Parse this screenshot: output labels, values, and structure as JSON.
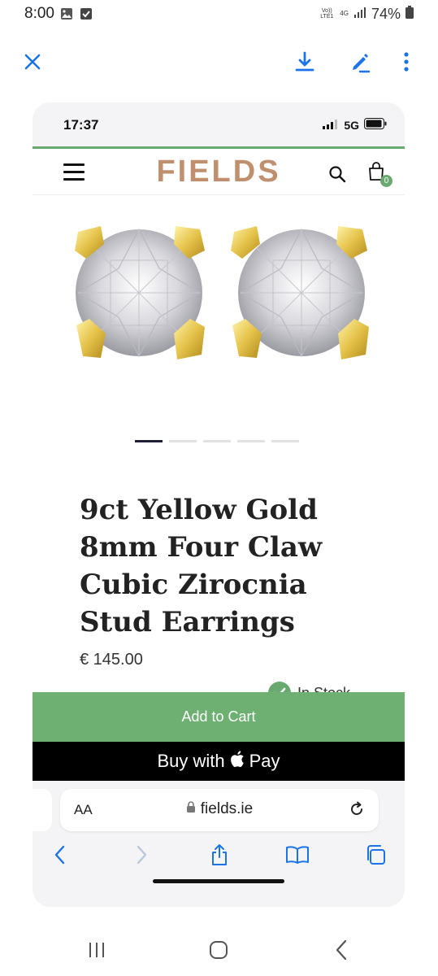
{
  "android_status": {
    "time": "8:00",
    "volte": "Vo)) LTE1",
    "network": "4G",
    "battery": "74%",
    "icons": [
      "gallery-icon",
      "checkbox-icon",
      "signal-icon",
      "battery-icon"
    ]
  },
  "viewer_toolbar": {
    "icons": [
      "close-icon",
      "download-icon",
      "edit-icon",
      "more-vert-icon"
    ],
    "accent_color": "#1a73e8"
  },
  "ios_status": {
    "time": "17:37",
    "network": "5G"
  },
  "site": {
    "logo": "FIELDS",
    "brand_color": "#c0906e",
    "accent_color": "#6aa96f",
    "cart_count": "0",
    "carousel": {
      "total": 5,
      "active": 1
    }
  },
  "product": {
    "title": "9ct Yellow Gold 8mm Four Claw Cubic Zirocnia Stud Earrings",
    "price": "€ 145.00",
    "stock": "In Stock"
  },
  "actions": {
    "add_to_cart": "Add to Cart",
    "buy_with": "Buy with",
    "pay": "Pay"
  },
  "safari": {
    "aa": "AA",
    "url": "fields.ie",
    "icons": [
      "back-icon",
      "forward-icon",
      "share-icon",
      "bookmarks-icon",
      "tabs-icon"
    ]
  },
  "android_nav": {
    "icons": [
      "recents-icon",
      "home-icon",
      "back-icon"
    ]
  }
}
